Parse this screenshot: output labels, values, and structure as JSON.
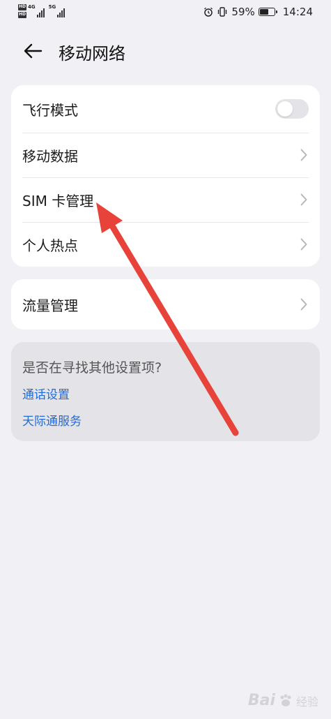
{
  "status_bar": {
    "sim1_hd": "HD",
    "sim1_net": "4G",
    "sim2_hd": "HD",
    "sim2_net": "5G",
    "battery_percent": "59%",
    "battery_level": 0.59,
    "time": "14:24",
    "icons": [
      "alarm-icon",
      "vibrate-icon",
      "battery-icon"
    ]
  },
  "header": {
    "title": "移动网络",
    "back_icon": "arrow-left-icon"
  },
  "main_card": {
    "items": [
      {
        "label": "飞行模式",
        "control": "toggle",
        "toggle_on": false
      },
      {
        "label": "移动数据",
        "control": "chevron"
      },
      {
        "label": "SIM 卡管理",
        "control": "chevron"
      },
      {
        "label": "个人热点",
        "control": "chevron"
      }
    ]
  },
  "traffic_card": {
    "label": "流量管理",
    "control": "chevron"
  },
  "suggestion": {
    "title": "是否在寻找其他设置项?",
    "links": [
      "通话设置",
      "天际通服务"
    ]
  },
  "annotation": {
    "color": "#e8433a",
    "icon": "red-arrow-annotation"
  },
  "watermark": {
    "text_en": "Bai",
    "text_cn": "经验"
  },
  "colors": {
    "background": "#f1f1f5",
    "card": "#ffffff",
    "link": "#1f6bd8",
    "suggest_bg": "#e4e4e8"
  }
}
